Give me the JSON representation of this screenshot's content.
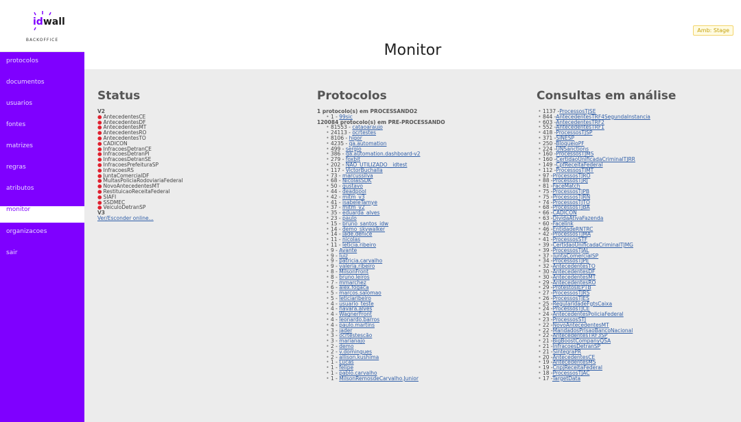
{
  "brand": {
    "logo_id": "id",
    "logo_wall": "wall",
    "logo_sub": "BACKOFFICE"
  },
  "nav": [
    {
      "label": "protocolos",
      "active": false
    },
    {
      "label": "documentos",
      "active": false
    },
    {
      "label": "usuarios",
      "active": false
    },
    {
      "label": "fontes",
      "active": false
    },
    {
      "label": "matrizes",
      "active": false
    },
    {
      "label": "regras",
      "active": false
    },
    {
      "label": "atributos",
      "active": false
    },
    {
      "label": "monitor",
      "active": true
    },
    {
      "label": "organizacoes",
      "active": false
    },
    {
      "label": "sair",
      "active": false
    }
  ],
  "header": {
    "env_badge": "Amb: Stage",
    "title": "Monitor"
  },
  "status": {
    "title": "Status",
    "v2_label": "V2",
    "v2_items": [
      "AntecedentesCE",
      "AntecedentesDF",
      "AntecedentesMT",
      "AntecedentesRO",
      "AntecedentesTO",
      "CADICON",
      "InfracoesDetranCE",
      "InfracoesDetranPI",
      "InfracoesDetranSE",
      "InfracoesPrefeituraSP",
      "InfracoesRS",
      "JuntaComercialDF",
      "MultasPoliciaRodoviariaFederal",
      "NovoAntecedentesMT",
      "RestituicaoReceitaFederal",
      "SIAFI",
      "SSDMEC",
      "VeiculoDetranSP"
    ],
    "v3_label": "V3",
    "toggle_link": "Ver/Esconder online..."
  },
  "protocolos": {
    "title": "Protocolos",
    "group1_header": "1 protocolo(s) em PROCESSANDO2",
    "group1_items": [
      {
        "count": "1",
        "user": "99sic"
      }
    ],
    "group2_header": "120084 protocolo(s) em PRE-PROCESSANDO",
    "group2_items": [
      {
        "count": "81553",
        "user": "cataoaraujo"
      },
      {
        "count": "24113",
        "user": "ocrtestes"
      },
      {
        "count": "8106",
        "user": "higor"
      },
      {
        "count": "4235",
        "user": "qa.automation"
      },
      {
        "count": "499",
        "user": "sergio"
      },
      {
        "count": "386",
        "user": "qa.automation.dashboard-v2"
      },
      {
        "count": "279",
        "user": "foxbit"
      },
      {
        "count": "202",
        "user": "NAO_UTILIZADO__idtest"
      },
      {
        "count": "117",
        "user": "VictorBuchalla"
      },
      {
        "count": "73",
        "user": "marcussilva"
      },
      {
        "count": "68",
        "user": "NicolasSDK"
      },
      {
        "count": "50",
        "user": "gustavo"
      },
      {
        "count": "44",
        "user": "deadpool"
      },
      {
        "count": "42",
        "user": "mitm_v3"
      },
      {
        "count": "41",
        "user": "isabeleTamye"
      },
      {
        "count": "37",
        "user": "mitm_v2"
      },
      {
        "count": "35",
        "user": "eduarda_alves"
      },
      {
        "count": "23",
        "user": "paulo"
      },
      {
        "count": "15",
        "user": "bruno_santos_idw"
      },
      {
        "count": "14",
        "user": "demo_skywalker"
      },
      {
        "count": "14",
        "user": "jade.denice"
      },
      {
        "count": "11",
        "user": "nicolas"
      },
      {
        "count": "11",
        "user": "leticia.ribeiro"
      },
      {
        "count": "9",
        "user": "Avante"
      },
      {
        "count": "9",
        "user": "luiz"
      },
      {
        "count": "9",
        "user": "patricia.carvalho"
      },
      {
        "count": "9",
        "user": "valeria.ribeiro"
      },
      {
        "count": "8",
        "user": "MilsonFront"
      },
      {
        "count": "8",
        "user": "bruno.leiros"
      },
      {
        "count": "7",
        "user": "mmarchez"
      },
      {
        "count": "6",
        "user": "alex.fogaca"
      },
      {
        "count": "5",
        "user": "marcos.salomao"
      },
      {
        "count": "5",
        "user": "leticiaribeiro"
      },
      {
        "count": "4",
        "user": "usuario_teste"
      },
      {
        "count": "4",
        "user": "navara.alves"
      },
      {
        "count": "4",
        "user": "WagnerFront"
      },
      {
        "count": "4",
        "user": "leonardo.barros"
      },
      {
        "count": "4",
        "user": "paulo.martins"
      },
      {
        "count": "3",
        "user": "jader"
      },
      {
        "count": "3",
        "user": "ocrtestescão"
      },
      {
        "count": "3",
        "user": "marianajo"
      },
      {
        "count": "2",
        "user": "demo"
      },
      {
        "count": "2",
        "user": "v.domingues"
      },
      {
        "count": "2",
        "user": "allison.kushima"
      },
      {
        "count": "1",
        "user": "Lucas"
      },
      {
        "count": "1",
        "user": "felipe"
      },
      {
        "count": "1",
        "user": "pablo.carvalho"
      },
      {
        "count": "1",
        "user": "MilsonRemosdeCarvalho.Junior"
      }
    ]
  },
  "consultas": {
    "title": "Consultas em análise",
    "items": [
      {
        "count": "1137",
        "name": "ProcessosTJSE"
      },
      {
        "count": "844",
        "name": "AntecedentesTRF4SegundaInstancia"
      },
      {
        "count": "603",
        "name": "AntecedentesTRF2"
      },
      {
        "count": "552",
        "name": "AntecedentesTRF1"
      },
      {
        "count": "418",
        "name": "ProcessosTJSP"
      },
      {
        "count": "371",
        "name": "SINESP"
      },
      {
        "count": "250",
        "name": "BloqueioPF"
      },
      {
        "count": "224",
        "name": "UNSanctions"
      },
      {
        "count": "160",
        "name": "ProcessosTJMS"
      },
      {
        "count": "160",
        "name": "CertidaoUnificadaCriminalTJRR"
      },
      {
        "count": "149",
        "name": "CpfReceitaFederal"
      },
      {
        "count": "112",
        "name": "ProcessosTJMT"
      },
      {
        "count": "97",
        "name": "ProcessosTJRO"
      },
      {
        "count": "88",
        "name": "ProcessosTJRJ"
      },
      {
        "count": "81",
        "name": "FaceMatch"
      },
      {
        "count": "75",
        "name": "ProcessosTJPB"
      },
      {
        "count": "75",
        "name": "ProcessosTJRN"
      },
      {
        "count": "74",
        "name": "ProcessosTJTO"
      },
      {
        "count": "68",
        "name": "ProcessosTJBA"
      },
      {
        "count": "66",
        "name": "CADICON"
      },
      {
        "count": "63",
        "name": "DividaAtivaFazenda"
      },
      {
        "count": "60",
        "name": "Facelink"
      },
      {
        "count": "46",
        "name": "EntidadeRNTRC"
      },
      {
        "count": "42",
        "name": "ProcessosTJMA"
      },
      {
        "count": "41",
        "name": "ProcessosSTF"
      },
      {
        "count": "39",
        "name": "CertidaoUnificadaCriminalTJMG"
      },
      {
        "count": "39",
        "name": "ProcessosTJAL"
      },
      {
        "count": "37",
        "name": "JuntaComercialSP"
      },
      {
        "count": "34",
        "name": "ProcessosTJPE"
      },
      {
        "count": "32",
        "name": "AntecedentesTO"
      },
      {
        "count": "30",
        "name": "AntecedentesDF"
      },
      {
        "count": "30",
        "name": "AntecedentesMT"
      },
      {
        "count": "29",
        "name": "AntecedentesRO"
      },
      {
        "count": "29",
        "name": "ProtestosIEPTB"
      },
      {
        "count": "27",
        "name": "ProcessosTJRS"
      },
      {
        "count": "26",
        "name": "ProcessosTJES"
      },
      {
        "count": "25",
        "name": "RegularidadeFgtsCaixa"
      },
      {
        "count": "24",
        "name": "ProcessosTJCE"
      },
      {
        "count": "24",
        "name": "AntecedentesPoliciaFederal"
      },
      {
        "count": "23",
        "name": "ProcessosSTJ"
      },
      {
        "count": "22",
        "name": "NovoAntecedentesMT"
      },
      {
        "count": "22",
        "name": "MandadosPrisaoBancoNacional"
      },
      {
        "count": "22",
        "name": "AntecedentesTRF3SP"
      },
      {
        "count": "21",
        "name": "BigBoostCompanyQSA"
      },
      {
        "count": "21",
        "name": "InfracoesDetranSP"
      },
      {
        "count": "21",
        "name": "SintegraPR"
      },
      {
        "count": "20",
        "name": "AntecedentesCE"
      },
      {
        "count": "19",
        "name": "AntecedentesMS"
      },
      {
        "count": "19",
        "name": "CnpjReceitaFederal"
      },
      {
        "count": "18",
        "name": "ProcessosTJAC"
      },
      {
        "count": "17",
        "name": "TargetData"
      }
    ]
  },
  "colors": {
    "accent": "#7f00ff",
    "status_dot": "#e0202e",
    "link": "#2f5ea8",
    "content_bg": "#ececec"
  }
}
